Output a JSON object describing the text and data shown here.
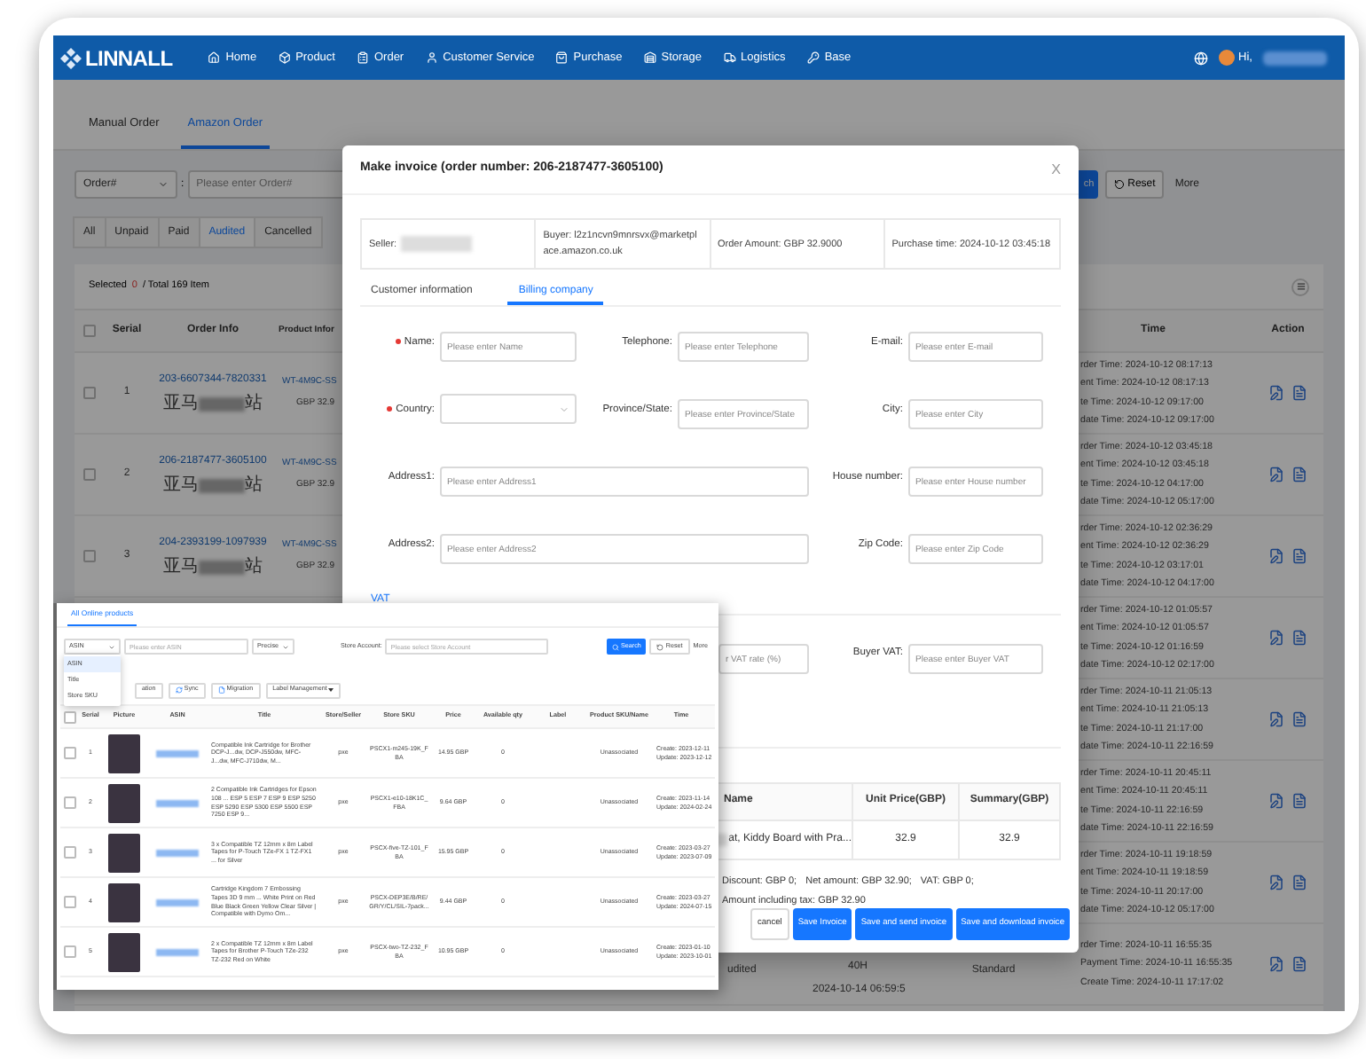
{
  "nav": {
    "logo": "LINNALL",
    "items": [
      {
        "label": "Home"
      },
      {
        "label": "Product"
      },
      {
        "label": "Order"
      },
      {
        "label": "Customer Service"
      },
      {
        "label": "Purchase"
      },
      {
        "label": "Storage"
      },
      {
        "label": "Logistics"
      },
      {
        "label": "Base"
      }
    ],
    "greeting": "Hi,"
  },
  "page_tabs": [
    {
      "label": "Manual Order",
      "selected": false
    },
    {
      "label": "Amazon Order",
      "selected": true
    }
  ],
  "filter": {
    "field": "Order#",
    "separator": ":",
    "placeholder": "Please enter Order#",
    "search_button": "ch",
    "reset_button": "Reset",
    "more": "More"
  },
  "status_tabs": [
    {
      "label": "All",
      "selected": false
    },
    {
      "label": "Unpaid",
      "selected": false
    },
    {
      "label": "Paid",
      "selected": false
    },
    {
      "label": "Audited",
      "selected": true
    },
    {
      "label": "Cancelled",
      "selected": false
    }
  ],
  "selection": {
    "label": "Selected",
    "count": "0",
    "total": "/ Total 169 Item"
  },
  "orders_table": {
    "header_checked": false,
    "columns": {
      "serial": "Serial",
      "order_info": "Order Info",
      "product_info": "Product Infor",
      "time": "Time",
      "action": "Action"
    },
    "rows": [
      {
        "checked": false,
        "serial": "1",
        "order_number": "203-6607344-7820331",
        "store_start": "亚马",
        "store_end": "站",
        "product": "WT-4M9C-SS",
        "price": "GBP 32.9",
        "time_lines": [
          "rder Time: 2024-10-12 08:17:13",
          "ent Time: 2024-10-12 08:17:13",
          "te Time: 2024-10-12 09:17:00",
          "date Time: 2024-10-12 09:17:00"
        ]
      },
      {
        "checked": false,
        "serial": "2",
        "order_number": "206-2187477-3605100",
        "store_start": "亚马",
        "store_end": "站",
        "product": "WT-4M9C-SS",
        "price": "GBP 32.9",
        "time_lines": [
          "rder Time: 2024-10-12 03:45:18",
          "ent Time: 2024-10-12 03:45:18",
          "te Time: 2024-10-12 04:17:00",
          "date Time: 2024-10-12 05:17:00"
        ]
      },
      {
        "checked": false,
        "serial": "3",
        "order_number": "204-2393199-1097939",
        "store_start": "亚马",
        "store_end": "站",
        "product": "WT-4M9C-SS",
        "price": "GBP 32.9",
        "time_lines": [
          "rder Time: 2024-10-12 02:36:29",
          "ent Time: 2024-10-12 02:36:29",
          "te Time: 2024-10-12 03:17:01",
          "date Time: 2024-10-12 04:17:00"
        ]
      },
      {
        "time_lines": [
          "rder Time: 2024-10-12 01:05:57",
          "ent Time: 2024-10-12 01:05:57",
          "te Time: 2024-10-12 01:16:59",
          "date Time: 2024-10-12 02:17:00"
        ]
      },
      {
        "time_lines": [
          "rder Time: 2024-10-11 21:05:13",
          "ent Time: 2024-10-11 21:05:13",
          "te Time: 2024-10-11 21:17:00",
          "date Time: 2024-10-11 22:16:59"
        ]
      },
      {
        "time_lines": [
          "rder Time: 2024-10-11 20:45:11",
          "ent Time: 2024-10-11 20:45:11",
          "te Time: 2024-10-11 22:16:59",
          "date Time: 2024-10-11 22:16:59"
        ]
      },
      {
        "time_lines": [
          "rder Time: 2024-10-11 19:18:59",
          "ent Time: 2024-10-11 19:18:59",
          "te Time: 2024-10-11 20:17:00",
          "date Time: 2024-10-12 05:17:00"
        ]
      },
      {
        "status": "udited",
        "hours": "40H",
        "date": "2024-10-14 06:59:5",
        "shipping": "Standard",
        "time_lines": [
          "rder Time: 2024-10-11 16:55:35",
          "Payment Time: 2024-10-11 16:55:35",
          "Create Time: 2024-10-11 17:17:02"
        ]
      }
    ]
  },
  "invoice_dialog": {
    "title": "Make invoice (order number: 206-2187477-3605100)",
    "close": "X",
    "info": {
      "seller_label": "Seller:",
      "buyer": "Buyer: l2z1ncvn9mnrsvx@marketplace.amazon.co.uk",
      "order_amount": "Order Amount: GBP 32.9000",
      "purchase_time": "Purchase time: 2024-10-12 03:45:18"
    },
    "tabs": [
      {
        "label": "Customer information",
        "selected": false
      },
      {
        "label": "Billing company",
        "selected": true
      }
    ],
    "form_rows": [
      [
        {
          "label": "Name:",
          "required": true,
          "kind": "input",
          "placeholder": "Please enter Name"
        },
        {
          "label": "Telephone:",
          "required": false,
          "kind": "input",
          "placeholder": "Please enter Telephone"
        },
        {
          "label": "E-mail:",
          "required": false,
          "kind": "input",
          "placeholder": "Please enter E-mail"
        }
      ],
      [
        {
          "label": "Country:",
          "required": true,
          "kind": "select"
        },
        {
          "label": "Province/State:",
          "required": false,
          "kind": "input",
          "placeholder": "Please enter Province/State"
        },
        {
          "label": "City:",
          "required": false,
          "kind": "input",
          "placeholder": "Please enter City"
        }
      ],
      [
        {
          "label": "Address1:",
          "required": false,
          "kind": "wide",
          "placeholder": "Please enter Address1"
        },
        {
          "label": "House number:",
          "required": false,
          "kind": "input",
          "placeholder": "Please enter House number"
        }
      ],
      [
        {
          "label": "Address2:",
          "required": false,
          "kind": "wide",
          "placeholder": "Please enter Address2"
        },
        {
          "label": "Zip Code:",
          "required": false,
          "kind": "input",
          "placeholder": "Please enter Zip Code"
        }
      ]
    ],
    "vat_tabs": [
      {
        "label": "VAT",
        "selected": true
      }
    ],
    "vat_rate": {
      "placeholder": "r VAT rate (%)"
    },
    "buyer_vat": {
      "label": "Buyer VAT:",
      "placeholder": "Please enter Buyer VAT"
    },
    "products": {
      "columns": [
        "Name",
        "Unit Price(GBP)",
        "Summary(GBP)"
      ],
      "rows": [
        {
          "name": "at, Kiddy Board with Pra...",
          "unit_price": "32.9",
          "summary": "32.9"
        }
      ]
    },
    "totals": [
      "Discount: GBP 0;",
      "Net amount: GBP 32.90;",
      "VAT: GBP 0;",
      "Amount including tax: GBP 32.90"
    ],
    "buttons": [
      {
        "label": "cancel",
        "kind": "secondary"
      },
      {
        "label": "Save Invoice",
        "kind": "primary"
      },
      {
        "label": "Save and send invoice",
        "kind": "primary"
      },
      {
        "label": "Save and download invoice",
        "kind": "primary"
      }
    ]
  },
  "products_window": {
    "tabs": [
      {
        "label": "All Online products",
        "selected": true
      }
    ],
    "filter": {
      "field": "ASIN",
      "options": [
        {
          "label": "ASIN",
          "selected": true
        },
        {
          "label": "Title",
          "selected": false
        },
        {
          "label": "Store SKU",
          "selected": false
        }
      ],
      "placeholder": "Please enter ASIN",
      "match": "Precise",
      "store_label": "Store Account:",
      "store_placeholder": "Please select Store Account",
      "search": "Search",
      "reset": "Reset",
      "more": "More"
    },
    "toolbar": [
      "ation",
      "Sync",
      "Migration",
      "Label Management"
    ],
    "header_checked": false,
    "columns": [
      "Serial",
      "Picture",
      "ASIN",
      "Title",
      "Store/Seller",
      "Store SKU",
      "Price",
      "Available qty",
      "Label",
      "Product SKU/Name",
      "Time"
    ],
    "rows": [
      {
        "checked": false,
        "serial": "1",
        "title": "Compatible Ink Cartridge for Brother DCP-J...dw, DCP-J550dw, MFC-J...dw, MFC-J710dw, M...",
        "store": "pxe",
        "sku": "PSCX1-m245-19K_FBA",
        "price": "14.95 GBP",
        "qty": "0",
        "product": "Unassociated",
        "time_lines": [
          "Create: 2023-12-11",
          "Update: 2023-12-12"
        ]
      },
      {
        "checked": false,
        "serial": "2",
        "title": "2 Compatible Ink Cartridges for Epson 108 ... ESP 5 ESP 7 ESP 9 ESP 5250 ESP 5290 ESP 5300 ESP 5500 ESP 7250 ESP 9...",
        "store": "pxe",
        "sku": "PSCX1-e10-18K1C_FBA",
        "price": "9.64 GBP",
        "qty": "0",
        "product": "Unassociated",
        "time_lines": [
          "Create: 2023-11-14",
          "Update: 2024-02-24"
        ]
      },
      {
        "checked": false,
        "serial": "3",
        "title": "3 x Compatible TZ 12mm x 8m Label Tapes for P-Touch TZe-FX 1 TZ-FX1 ... for Silver",
        "store": "pxe",
        "sku": "PSCX-five-TZ-101_FBA",
        "price": "15.95 GBP",
        "qty": "0",
        "product": "Unassociated",
        "time_lines": [
          "Create: 2023-03-27",
          "Update: 2023-07-09"
        ]
      },
      {
        "checked": false,
        "serial": "4",
        "title": "Cartridge Kingdom 7 Embossing Tapes 3D 9 mm ... White Print on Red Blue Black Green Yellow Clear Silver | Compatible with Dymo Om...",
        "store": "pxe",
        "sku": "PSCX-DEP3E/B/RE/GR/Y/CL/SIL-7pack...",
        "price": "9.44 GBP",
        "qty": "0",
        "product": "Unassociated",
        "time_lines": [
          "Create: 2023-03-27",
          "Update: 2024-07-15"
        ]
      },
      {
        "checked": false,
        "serial": "5",
        "title": "2 x Compatible TZ 12mm x 8m Label Tapes for Brother P-Touch TZe-232 TZ-232 Red on White",
        "store": "pxe",
        "sku": "PSCX-two-TZ-232_FBA",
        "price": "10.95 GBP",
        "qty": "0",
        "product": "Unassociated",
        "time_lines": [
          "Create: 2023-01-10",
          "Update: 2023-10-01"
        ]
      }
    ]
  }
}
